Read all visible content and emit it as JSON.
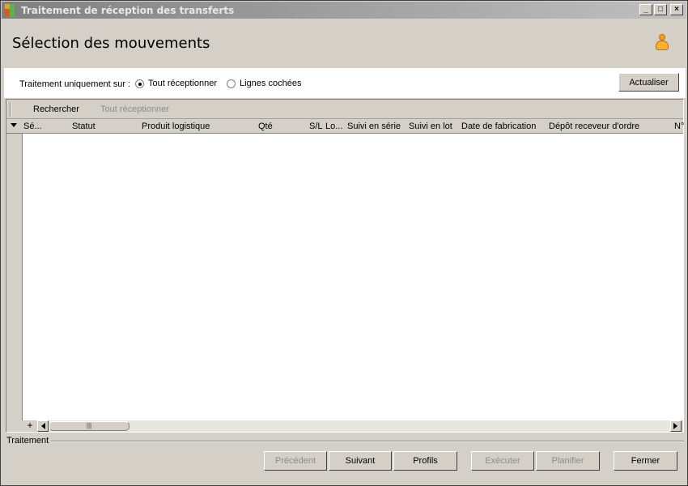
{
  "window": {
    "title": "Traitement de réception des transferts",
    "controls": {
      "minimize": "_",
      "maximize": "□",
      "close": "×"
    }
  },
  "header": {
    "title": "Sélection des mouvements",
    "user_icon": "user-icon"
  },
  "options": {
    "label": "Traitement uniquement sur :",
    "radio_all": {
      "label": "Tout réceptionner",
      "checked": true
    },
    "radio_checked": {
      "label": "Lignes cochées",
      "checked": false
    },
    "refresh_label": "Actualiser"
  },
  "grid": {
    "toolbar": {
      "search_label": "Rechercher",
      "receive_all_label": "Tout réceptionner"
    },
    "columns": [
      "Sé...",
      "Statut",
      "Produit logistique",
      "Qté",
      "S/L",
      "Lo...",
      "Suivi en série",
      "Suivi en lot",
      "Date de fabrication",
      "Dépôt receveur d'ordre",
      "N°"
    ],
    "rows": [],
    "add_label": "+",
    "scroll_thumb_grip": "|||"
  },
  "footer": {
    "section_label": "Traitement",
    "buttons": {
      "previous": "Précédent",
      "next": "Suivant",
      "profiles": "Profils",
      "execute": "Exécuter",
      "schedule": "Planifier",
      "close": "Fermer"
    }
  }
}
